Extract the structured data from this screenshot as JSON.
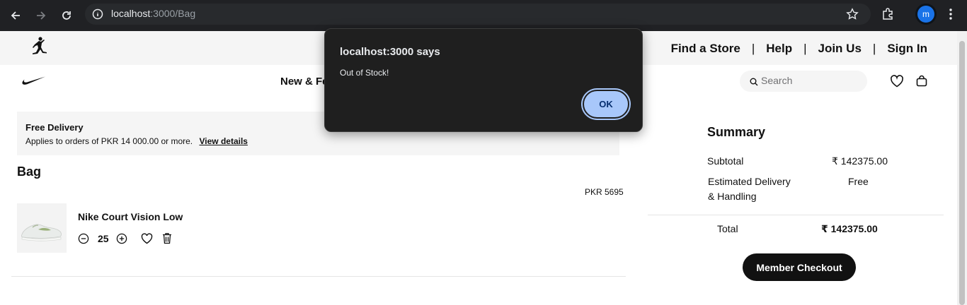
{
  "browser": {
    "url_host": "localhost",
    "url_path": ":3000/Bag",
    "profile_initial": "m"
  },
  "utility_links": [
    "Find a Store",
    "Help",
    "Join Us",
    "Sign In"
  ],
  "utility_separator": "|",
  "nav": {
    "visible_item": "New & Fe"
  },
  "search": {
    "placeholder": "Search"
  },
  "banner": {
    "title": "Free Delivery",
    "text": "Applies to orders of PKR 14 000.00 or more.",
    "link": "View details"
  },
  "bag": {
    "title": "Bag",
    "items": [
      {
        "name": "Nike Court Vision Low",
        "price": "PKR 5695",
        "quantity": "25"
      }
    ]
  },
  "summary": {
    "title": "Summary",
    "subtotal_label": "Subtotal",
    "subtotal_value": "₹ 142375.00",
    "delivery_label_line1": "Estimated Delivery",
    "delivery_label_line2": "& Handling",
    "delivery_value": "Free",
    "total_label": "Total",
    "total_value": "₹ 142375.00",
    "checkout_label": "Member Checkout"
  },
  "dialog": {
    "title": "localhost:3000 says",
    "message": "Out of Stock!",
    "ok_label": "OK"
  },
  "colors": {
    "chrome_bg": "#202124",
    "dialog_bg": "#1f1f1f",
    "ok_button": "#a8c7fa",
    "checkout_button": "#111111"
  }
}
